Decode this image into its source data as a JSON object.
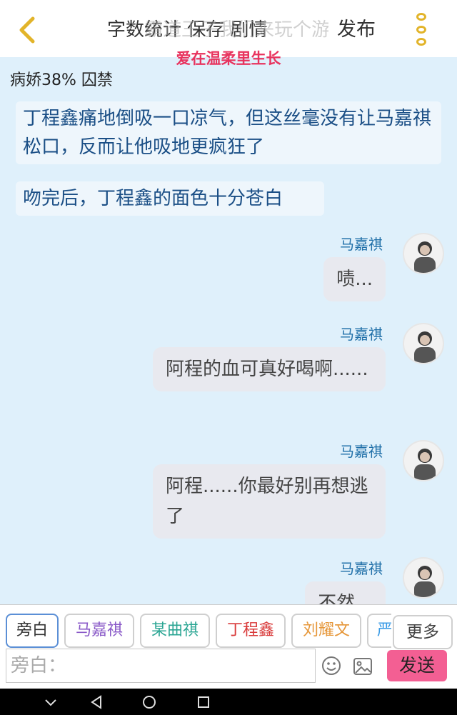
{
  "header": {
    "title_layer1": "字数统计  保存  剧情",
    "title_layer2": "霸道王子我们来玩个游戏",
    "publish_label": "发布",
    "subtitle": "爱在温柔里生长"
  },
  "status": "病娇38%  囚禁",
  "narrations": [
    "丁程鑫痛地倒吸一口凉气，但这丝毫没有让马嘉祺松口，反而让他吸地更疯狂了",
    "吻完后，丁程鑫的面色十分苍白"
  ],
  "messages": [
    {
      "sender": "马嘉祺",
      "text": "啧..."
    },
    {
      "sender": "马嘉祺",
      "text": "阿程的血可真好喝啊......"
    },
    {
      "sender": "马嘉祺",
      "text": "阿程......你最好别再想逃了"
    },
    {
      "sender": "马嘉祺",
      "text": "不然..."
    }
  ],
  "toolbar": {
    "chips": [
      {
        "label": "旁白",
        "color": "#333333"
      },
      {
        "label": "马嘉祺",
        "color": "#8a5ac8"
      },
      {
        "label": "某曲祺",
        "color": "#2aa593"
      },
      {
        "label": "丁程鑫",
        "color": "#d93a3a"
      },
      {
        "label": "刘耀文",
        "color": "#e6973a"
      },
      {
        "label": "严",
        "color": "#3a9be6"
      }
    ],
    "more_label": "更多",
    "input_placeholder": "旁白：",
    "send_label": "发送"
  },
  "colors": {
    "background": "#dff0fb",
    "accent_pink": "#f35f93",
    "subtitle_red": "#e8335e",
    "icon_gold": "#e2b42a"
  }
}
